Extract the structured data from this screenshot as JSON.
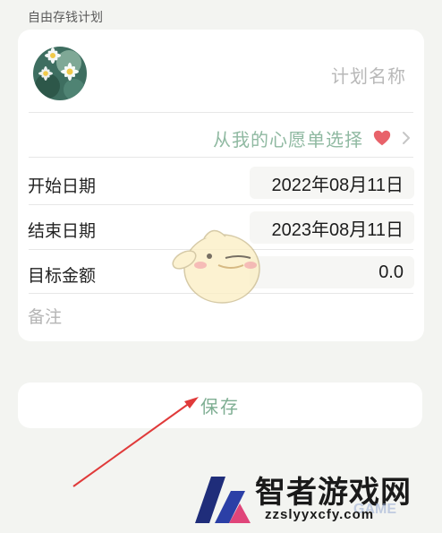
{
  "header": {
    "section_title": "自由存钱计划"
  },
  "plan": {
    "name_placeholder": "计划名称",
    "wishlist_link": "从我的心愿单选择"
  },
  "form": {
    "start_date_label": "开始日期",
    "start_date_value": "2022年08月11日",
    "end_date_label": "结束日期",
    "end_date_value": "2023年08月11日",
    "target_amount_label": "目标金额",
    "target_amount_value": "0.0",
    "note_placeholder": "备注"
  },
  "actions": {
    "save_label": "保存"
  },
  "watermark": {
    "title": "智者游戏网",
    "url": "zzslyyxcfy.com",
    "game": "GAME"
  },
  "colors": {
    "accent_green": "#8fb9a1",
    "heart_red": "#e8626a",
    "arrow_red": "#e03a3a"
  },
  "icons": {
    "avatar": "daisy-avatar-icon",
    "heart": "heart-icon",
    "chevron": "chevron-right-icon"
  }
}
